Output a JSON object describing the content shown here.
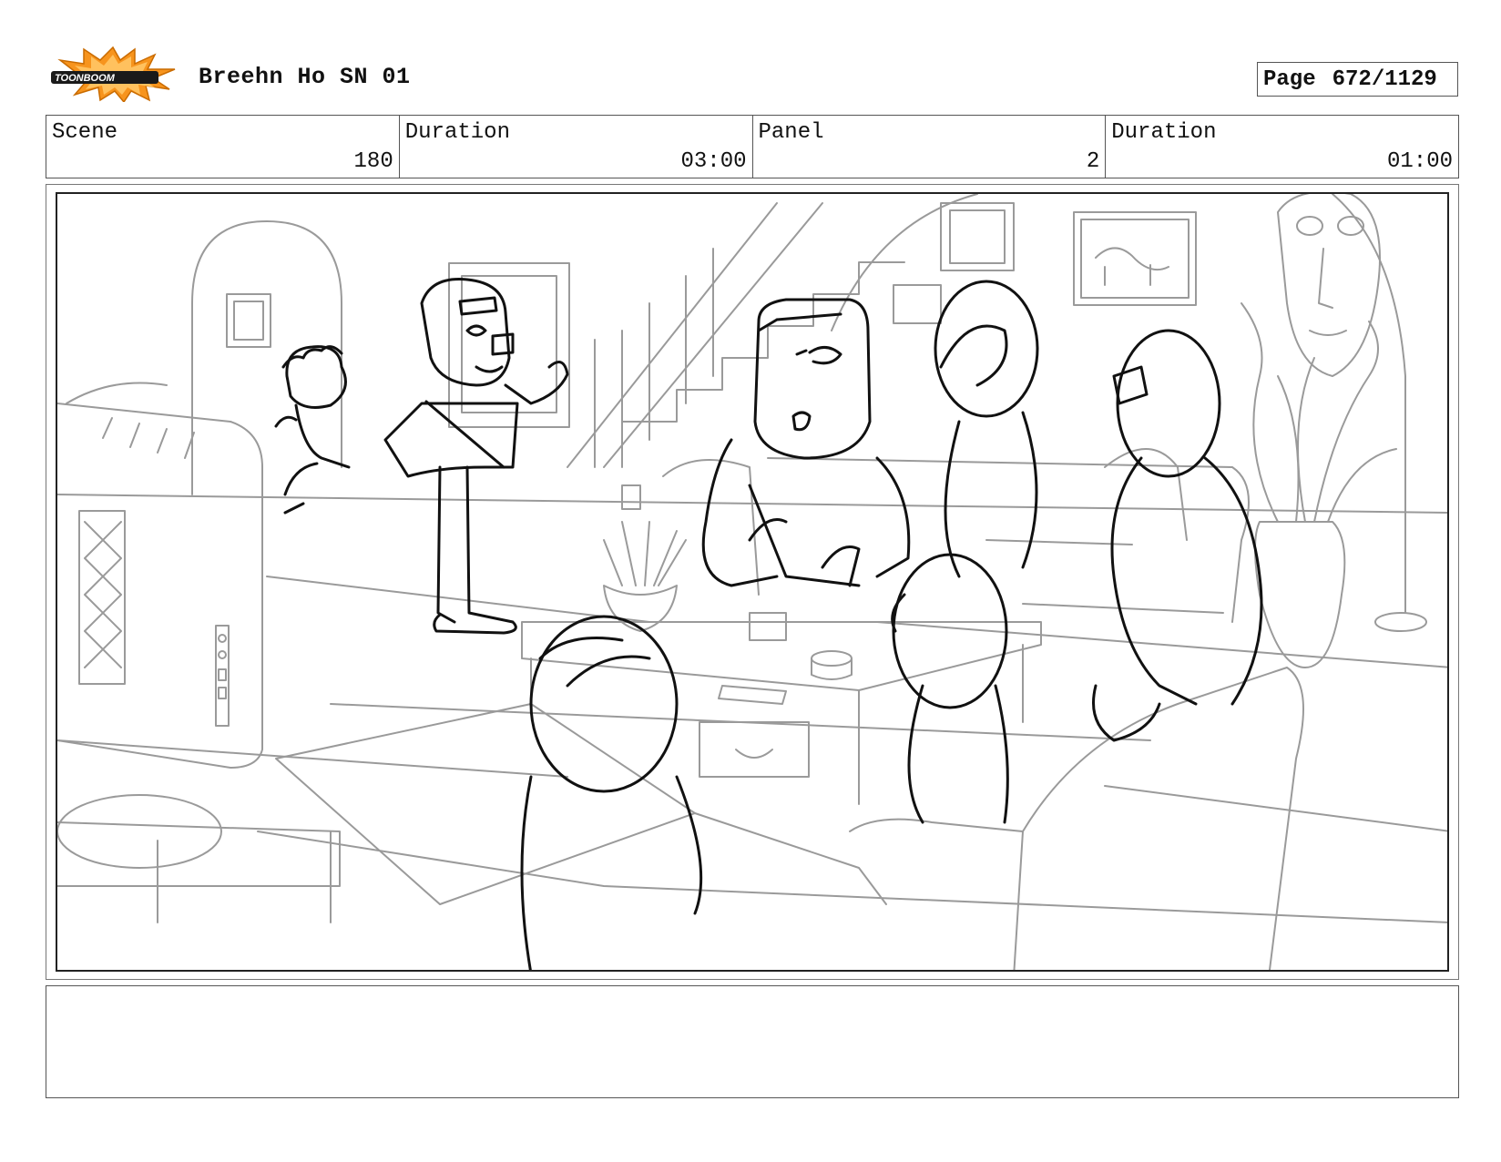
{
  "header": {
    "logo_text": "TOONBOOM",
    "title": "Breehn Ho SN 01",
    "page_label": "Page",
    "page_value": "672/1129"
  },
  "info": {
    "scene_label": "Scene",
    "scene_value": "180",
    "duration_label": "Duration",
    "duration_value": "03:00",
    "panel_label": "Panel",
    "panel_value": "2",
    "panel_duration_label": "Duration",
    "panel_duration_value": "01:00"
  },
  "notes": {
    "text": ""
  },
  "colors": {
    "logo_orange": "#f7941d",
    "logo_dark": "#1a1a1a",
    "line_light": "#9a9a9a",
    "line_dark": "#111111"
  }
}
